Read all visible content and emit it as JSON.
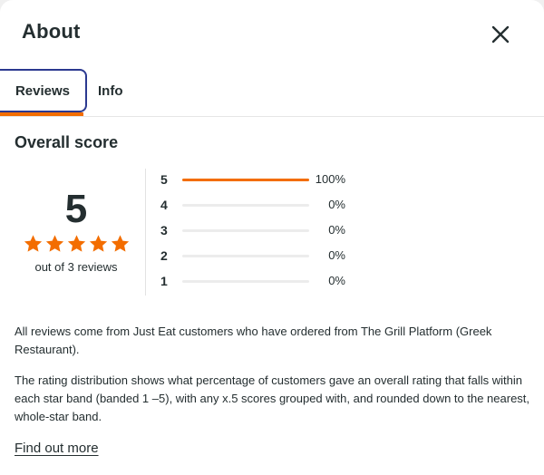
{
  "header": {
    "title": "About"
  },
  "tabs": [
    {
      "label": "Reviews",
      "active": true
    },
    {
      "label": "Info",
      "active": false
    }
  ],
  "overall": {
    "title": "Overall score",
    "score": "5",
    "stars": 5,
    "out_of": "out of 3 reviews"
  },
  "distribution": [
    {
      "label": "5",
      "percent": 100,
      "percent_label": "100%"
    },
    {
      "label": "4",
      "percent": 0,
      "percent_label": "0%"
    },
    {
      "label": "3",
      "percent": 0,
      "percent_label": "0%"
    },
    {
      "label": "2",
      "percent": 0,
      "percent_label": "0%"
    },
    {
      "label": "1",
      "percent": 0,
      "percent_label": "0%"
    }
  ],
  "info": {
    "paragraph1": "All reviews come from Just Eat customers who have ordered from The Grill Platform (Greek Restaurant).",
    "paragraph2": "The rating distribution shows what percentage of customers gave an overall rating that falls within each star band (banded 1 –5), with any x.5 scores grouped with, and rounded down to the nearest, whole-star band.",
    "link": "Find out more"
  },
  "colors": {
    "accent": "#f36d00",
    "focus": "#2b3990",
    "text": "#242e30"
  },
  "icons": {
    "close": "close-icon",
    "star": "star-icon"
  }
}
